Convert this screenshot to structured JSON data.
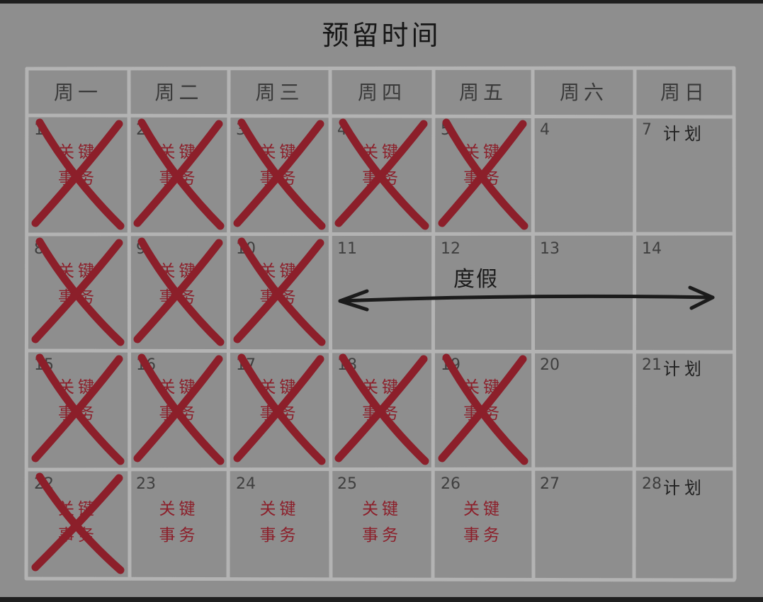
{
  "title": "预留时间",
  "weekdays": [
    "周一",
    "周二",
    "周三",
    "周四",
    "周五",
    "周六",
    "周日"
  ],
  "weeks": [
    [
      {
        "date": "1",
        "task": [
          "关键",
          "事务"
        ],
        "crossed": true
      },
      {
        "date": "2",
        "task": [
          "关键",
          "事务"
        ],
        "crossed": true
      },
      {
        "date": "3",
        "task": [
          "关键",
          "事务"
        ],
        "crossed": true
      },
      {
        "date": "4",
        "task": [
          "关键",
          "事务"
        ],
        "crossed": true
      },
      {
        "date": "5",
        "task": [
          "关键",
          "事务"
        ],
        "crossed": true
      },
      {
        "date": "4",
        "task": null,
        "crossed": false
      },
      {
        "date": "7",
        "plan": "计划",
        "crossed": false
      }
    ],
    [
      {
        "date": "8",
        "task": [
          "关键",
          "事务"
        ],
        "crossed": true
      },
      {
        "date": "9",
        "task": [
          "关键",
          "事务"
        ],
        "crossed": true
      },
      {
        "date": "10",
        "task": [
          "关键",
          "事务"
        ],
        "crossed": true
      },
      {
        "date": "11",
        "task": null,
        "crossed": false
      },
      {
        "date": "12",
        "task": null,
        "crossed": false
      },
      {
        "date": "13",
        "task": null,
        "crossed": false
      },
      {
        "date": "14",
        "task": null,
        "crossed": false
      }
    ],
    [
      {
        "date": "15",
        "task": [
          "关键",
          "事务"
        ],
        "crossed": true
      },
      {
        "date": "16",
        "task": [
          "关键",
          "事务"
        ],
        "crossed": true
      },
      {
        "date": "17",
        "task": [
          "关键",
          "事务"
        ],
        "crossed": true
      },
      {
        "date": "18",
        "task": [
          "关键",
          "事务"
        ],
        "crossed": true
      },
      {
        "date": "19",
        "task": [
          "关键",
          "事务"
        ],
        "crossed": true
      },
      {
        "date": "20",
        "task": null,
        "crossed": false
      },
      {
        "date": "21",
        "plan": "计划",
        "crossed": false
      }
    ],
    [
      {
        "date": "22",
        "task": [
          "关键",
          "事务"
        ],
        "crossed": true
      },
      {
        "date": "23",
        "task": [
          "关键",
          "事务"
        ],
        "crossed": false
      },
      {
        "date": "24",
        "task": [
          "关键",
          "事务"
        ],
        "crossed": false
      },
      {
        "date": "25",
        "task": [
          "关键",
          "事务"
        ],
        "crossed": false
      },
      {
        "date": "26",
        "task": [
          "关键",
          "事务"
        ],
        "crossed": false
      },
      {
        "date": "27",
        "task": null,
        "crossed": false
      },
      {
        "date": "28",
        "plan": "计划",
        "crossed": false
      }
    ]
  ],
  "vacation": {
    "label": "度假",
    "from_weekday": "周四",
    "to_weekday": "周日"
  },
  "colors": {
    "background": "#8e8e8e",
    "grid": "#b3b3b3",
    "cross": "#8c1f2a",
    "task_text": "#8c1f2a",
    "arrow": "#1b1b1b"
  }
}
